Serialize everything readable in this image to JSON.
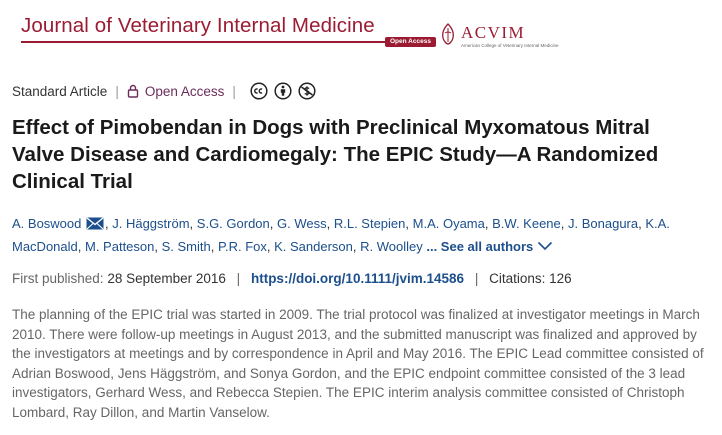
{
  "journal": {
    "title": "Journal of Veterinary Internal Medicine",
    "open_access_badge": "Open Access",
    "partner_logo": "ACVIM",
    "partner_tagline": "American College of Veterinary Internal Medicine",
    "brand_color": "#9b1b32"
  },
  "meta": {
    "article_type": "Standard Article",
    "access": "Open Access",
    "license_icons": [
      "cc-icon",
      "by-icon",
      "nc-icon"
    ]
  },
  "article": {
    "title": "Effect of Pimobendan in Dogs with Preclinical Myxomatous Mitral Valve Disease and Cardiomegaly: The EPIC Study—A Randomized Clinical Trial",
    "authors": [
      "A. Boswood",
      "J. Häggström",
      "S.G. Gordon",
      "G. Wess",
      "R.L. Stepien",
      "M.A. Oyama",
      "B.W. Keene",
      "J. Bonagura",
      "K.A. MacDonald",
      "M. Patteson",
      "S. Smith",
      "P.R. Fox",
      "K. Sanderson",
      "R. Woolley"
    ],
    "see_all": "... See all authors",
    "first_published_label": "First published:",
    "first_published": "28 September 2016",
    "doi": "https://doi.org/10.1111/jvim.14586",
    "citations": "Citations: 126",
    "abstract": "The planning of the EPIC trial was started in 2009. The trial protocol was finalized at investigator meetings in March 2010. There were follow-up meetings in August 2013, and the submitted manuscript was finalized and approved by the investigators at meetings and by correspondence in April and May 2016. The EPIC Lead committee consisted of Adrian Boswood, Jens Häggström, and Sonya Gordon, and the EPIC endpoint committee consisted of the 3 lead investigators, Gerhard Wess, and Rebecca Stepien. The EPIC interim analysis committee consisted of Christoph Lombard, Ray Dillon, and Martin Vanselow."
  }
}
